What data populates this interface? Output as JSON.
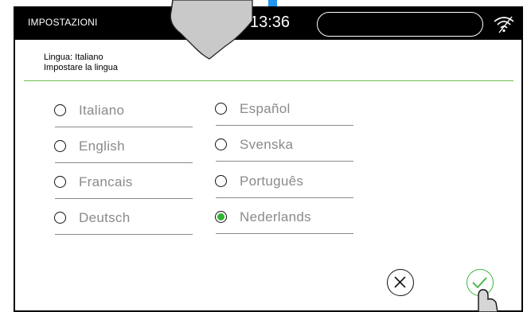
{
  "header": {
    "title": "IMPOSTAZIONI",
    "time": "13:36"
  },
  "section": {
    "current": "Lingua: Italiano",
    "instruction": "Impostare la lingua"
  },
  "languages": [
    {
      "label": "Italiano",
      "selected": false
    },
    {
      "label": "English",
      "selected": false
    },
    {
      "label": "Francais",
      "selected": false
    },
    {
      "label": "Deutsch",
      "selected": false
    },
    {
      "label": "Español",
      "selected": false
    },
    {
      "label": "Svenska",
      "selected": false
    },
    {
      "label": "Português",
      "selected": false
    },
    {
      "label": "Nederlands",
      "selected": true
    }
  ],
  "icons": {
    "wifi": "wifi-icon",
    "cancel": "close-circle-icon",
    "confirm": "check-circle-icon"
  },
  "colors": {
    "accent": "#3cb43c",
    "divider": "#6cbf4a",
    "header": "#000000"
  }
}
